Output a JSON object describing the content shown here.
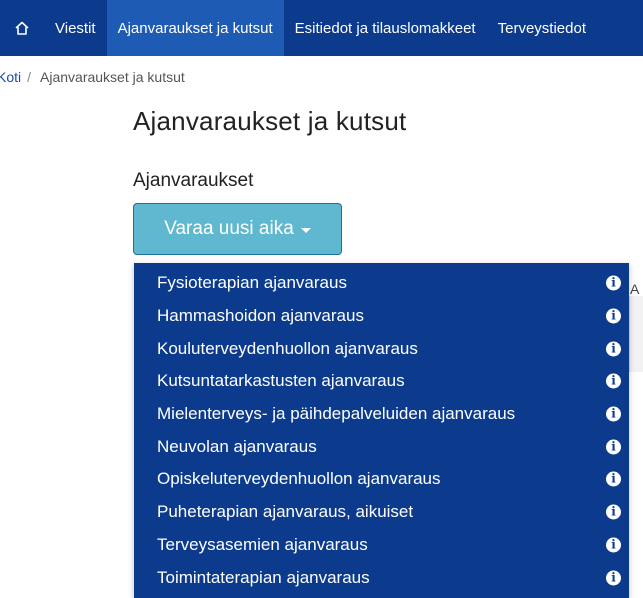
{
  "topnav": {
    "home_icon": "home-icon",
    "items": [
      {
        "label": "Viestit"
      },
      {
        "label": "Ajanvaraukset ja kutsut",
        "active": true
      },
      {
        "label": "Esitiedot ja tilauslomakkeet"
      },
      {
        "label": "Terveystiedot"
      }
    ]
  },
  "breadcrumb": {
    "home": "Koti",
    "separator": "/",
    "current": "Ajanvaraukset ja kutsut"
  },
  "main": {
    "title": "Ajanvaraukset ja kutsut",
    "section_title": "Ajanvaraukset",
    "booking_button": "Varaa uusi aika"
  },
  "dropdown": {
    "items": [
      {
        "label": "Fysioterapian ajanvaraus"
      },
      {
        "label": "Hammashoidon ajanvaraus"
      },
      {
        "label": "Kouluterveydenhuollon ajanvaraus"
      },
      {
        "label": "Kutsuntatarkastusten ajanvaraus"
      },
      {
        "label": "Mielenterveys- ja päihdepalveluiden ajanvaraus"
      },
      {
        "label": "Neuvolan ajanvaraus"
      },
      {
        "label": "Opiskeluterveydenhuollon ajanvaraus"
      },
      {
        "label": "Puheterapian ajanvaraus, aikuiset"
      },
      {
        "label": "Terveysasemien ajanvaraus"
      },
      {
        "label": "Toimintaterapian ajanvaraus"
      }
    ],
    "info_icon_glyph": "i"
  },
  "background": {
    "partial_letter": "A"
  },
  "colors": {
    "nav_bg": "#0c3b8e",
    "nav_active": "#1e5bb5",
    "button_bg": "#5fb8cf",
    "dropdown_bg": "#0c3b8e"
  }
}
